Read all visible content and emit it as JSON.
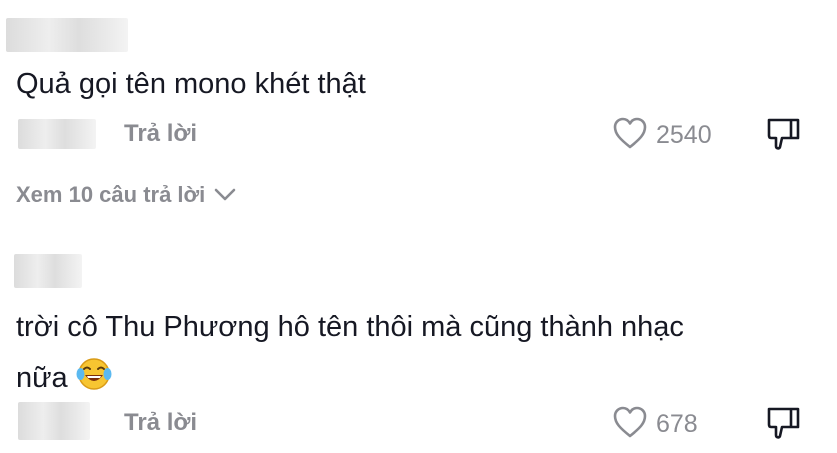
{
  "comments": [
    {
      "text": "Quả gọi tên mono khét thật",
      "reply_label": "Trả lời",
      "likes": "2540"
    },
    {
      "text_line1": "trời cô Thu Phương hô tên thôi mà cũng thành nhạc",
      "text_line2": "nữa",
      "emoji": "laughing-tears-emoji",
      "reply_label": "Trả lời",
      "likes": "678"
    }
  ],
  "view_replies_label": "Xem 10 câu trả lời",
  "icons": {
    "like": "heart-outline-icon",
    "dislike": "thumbs-down-icon",
    "expand": "chevron-down-icon"
  },
  "colors": {
    "text": "#161823",
    "muted": "#8a8b91"
  }
}
